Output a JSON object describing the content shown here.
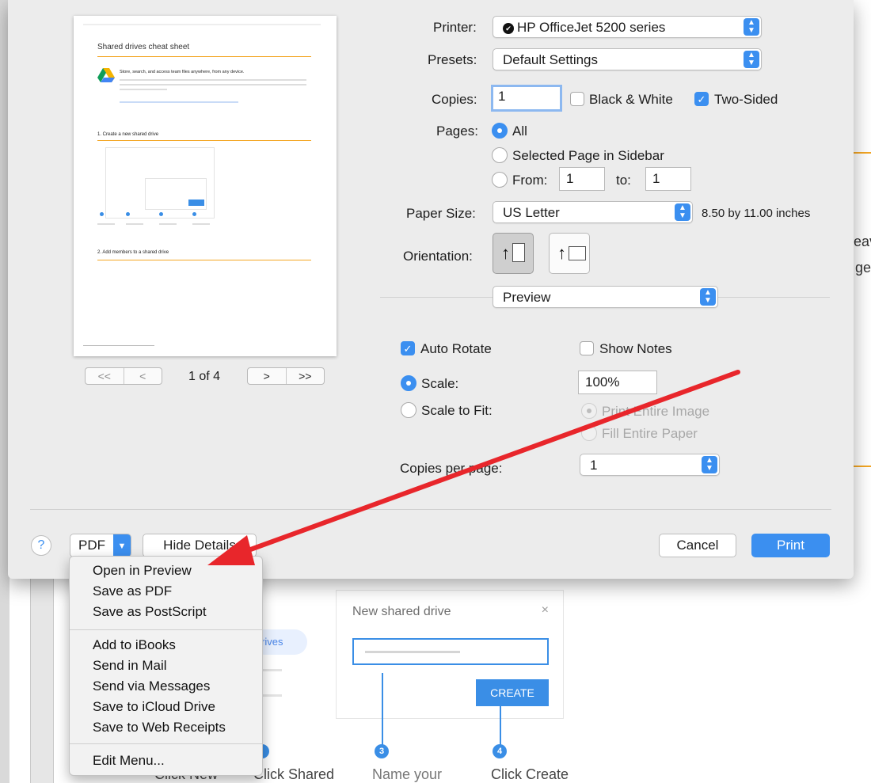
{
  "background": {
    "right_text_1": "eav",
    "right_text_2": "ge",
    "card_title": "New shared drive",
    "card_close": "×",
    "card_create": "CREATE",
    "pill_text": "rives",
    "step_3": "3",
    "step_4": "4",
    "caption_1": "Click New",
    "caption_2": "Click Shared",
    "caption_3": "Name your",
    "caption_4": "Click Create"
  },
  "preview": {
    "page_title": "Shared drives cheat sheet",
    "tagline": "Store, search, and access team files anywhere, from any device.",
    "section_1": "1. Create a new shared drive",
    "section_2": "2. Add members to a shared drive",
    "page_indicator": "1 of 4",
    "nav_first": "<<",
    "nav_prev": "<",
    "nav_next": ">",
    "nav_last": ">>"
  },
  "form": {
    "printer_label": "Printer:",
    "printer_value": "HP OfficeJet 5200 series",
    "presets_label": "Presets:",
    "presets_value": "Default Settings",
    "copies_label": "Copies:",
    "copies_value": "1",
    "bw_label": "Black & White",
    "two_sided_label": "Two-Sided",
    "pages_label": "Pages:",
    "pages_all": "All",
    "pages_selected": "Selected Page in Sidebar",
    "pages_from": "From:",
    "pages_from_value": "1",
    "pages_to": "to:",
    "pages_to_value": "1",
    "paper_size_label": "Paper Size:",
    "paper_size_value": "US Letter",
    "paper_size_dims": "8.50 by 11.00 inches",
    "orientation_label": "Orientation:",
    "app_menu_value": "Preview",
    "auto_rotate": "Auto Rotate",
    "show_notes": "Show Notes",
    "scale_label": "Scale:",
    "scale_value": "100%",
    "scale_to_fit": "Scale to Fit:",
    "print_entire_image": "Print Entire Image",
    "fill_entire_paper": "Fill Entire Paper",
    "copies_per_page_label": "Copies per page:",
    "copies_per_page_value": "1"
  },
  "footer": {
    "help": "?",
    "pdf": "PDF",
    "hide_details": "Hide Details",
    "cancel": "Cancel",
    "print": "Print"
  },
  "pdf_menu": {
    "items_a": [
      "Open in Preview",
      "Save as PDF",
      "Save as PostScript"
    ],
    "items_b": [
      "Add to iBooks",
      "Send in Mail",
      "Send via Messages",
      "Save to iCloud Drive",
      "Save to Web Receipts"
    ],
    "items_c": [
      "Edit Menu..."
    ]
  },
  "colors": {
    "accent": "#3b8ff0",
    "arrow": "#e8262b",
    "dialog_bg": "#ececec"
  }
}
